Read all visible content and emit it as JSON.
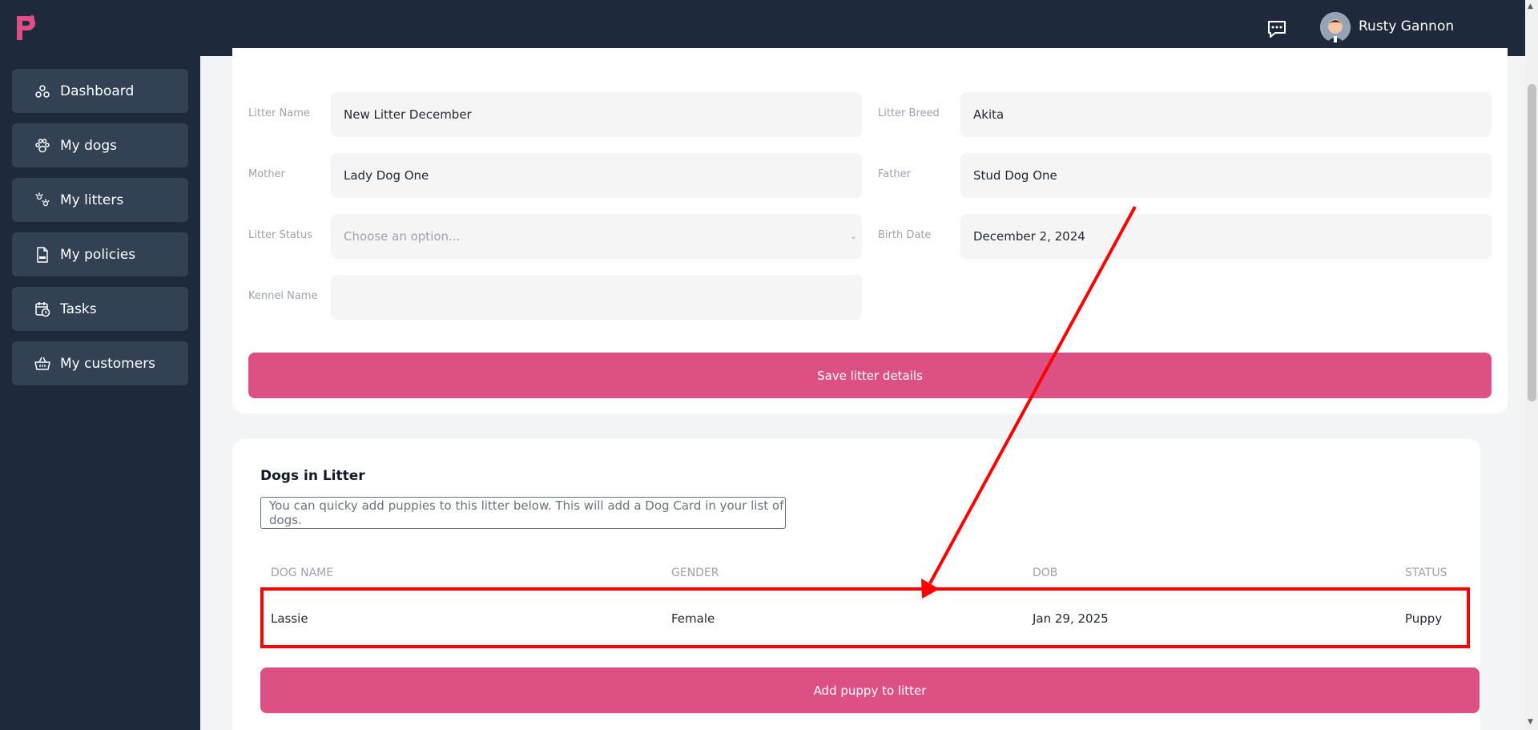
{
  "header": {
    "user_name": "Rusty Gannon",
    "brand_color": "#dc5083",
    "bg_color": "#1e293b"
  },
  "sidebar": {
    "items": [
      {
        "label": "Dashboard",
        "icon": "dashboard-icon"
      },
      {
        "label": "My dogs",
        "icon": "paw-icon"
      },
      {
        "label": "My litters",
        "icon": "paws-icon"
      },
      {
        "label": "My policies",
        "icon": "pdf-file-icon"
      },
      {
        "label": "Tasks",
        "icon": "calendar-clock-icon"
      },
      {
        "label": "My customers",
        "icon": "basket-icon"
      }
    ]
  },
  "form": {
    "litter_name_label": "Litter Name",
    "litter_name_value": "New Litter December",
    "litter_breed_label": "Litter Breed",
    "litter_breed_value": "Akita",
    "mother_label": "Mother",
    "mother_value": "Lady Dog One",
    "father_label": "Father",
    "father_value": "Stud Dog One",
    "litter_status_label": "Litter Status",
    "litter_status_placeholder": "Choose an option...",
    "birth_date_label": "Birth Date",
    "birth_date_value": "December 2, 2024",
    "kennel_name_label": "Kennel Name",
    "kennel_name_value": "",
    "save_button": "Save litter details"
  },
  "litter_dogs": {
    "title": "Dogs in Litter",
    "notice": "You can quicky add puppies to this litter below. This will add a Dog Card in your list of dogs.",
    "columns": [
      "DOG NAME",
      "GENDER",
      "DOB",
      "STATUS"
    ],
    "rows": [
      {
        "name": "Lassie",
        "gender": "Female",
        "dob": "Jan 29, 2025",
        "status": "Puppy"
      }
    ],
    "add_button": "Add puppy to litter"
  },
  "annotation": {
    "color": "#ff0000"
  }
}
